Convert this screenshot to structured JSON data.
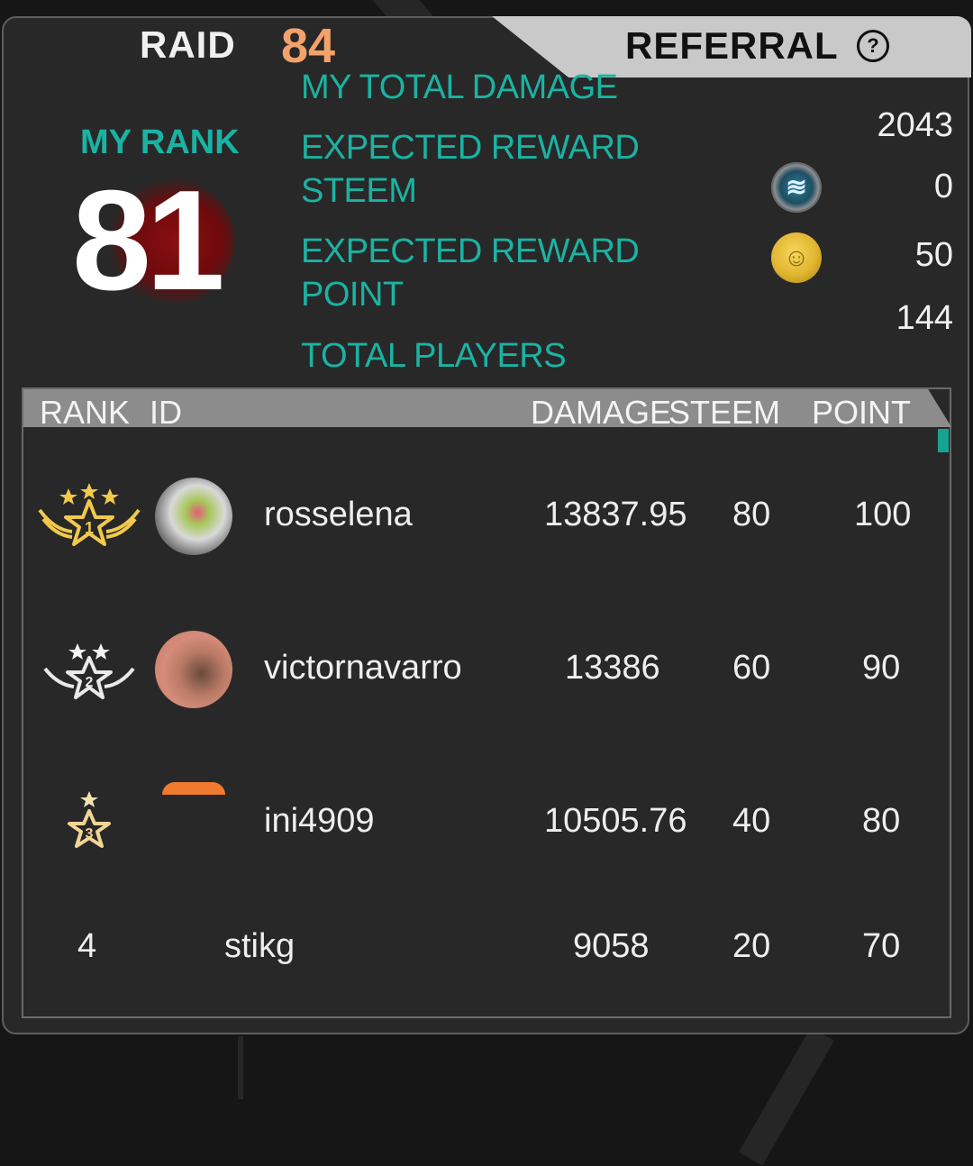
{
  "tabs": {
    "raid_label": "RAID",
    "raid_number": "84",
    "referral_label": "REFERRAL",
    "help_glyph": "?"
  },
  "summary": {
    "my_rank_label": "MY RANK",
    "my_rank_value": "81",
    "total_damage_label": "MY TOTAL DAMAGE",
    "total_damage_value": "2043",
    "reward_steem_label_1": "EXPECTED REWARD",
    "reward_steem_label_2": "STEEM",
    "reward_steem_value": "0",
    "reward_point_label_1": "EXPECTED REWARD",
    "reward_point_label_2": "POINT",
    "reward_point_value": "50",
    "total_players_label": "TOTAL PLAYERS",
    "total_players_value": "144",
    "steem_icon": "steem-coin-icon",
    "point_icon": "gold-point-coin-icon"
  },
  "table": {
    "headers": {
      "rank": "RANK",
      "id": "ID",
      "damage": "DAMAGE",
      "steem": "STEEM",
      "point": "POINT"
    },
    "rows": [
      {
        "rank": "1",
        "id": "rosselena",
        "damage": "13837.95",
        "steem": "80",
        "point": "100"
      },
      {
        "rank": "2",
        "id": "victornavarro",
        "damage": "13386",
        "steem": "60",
        "point": "90"
      },
      {
        "rank": "3",
        "id": "ini4909",
        "damage": "10505.76",
        "steem": "40",
        "point": "80"
      },
      {
        "rank": "4",
        "id": "stikg",
        "damage": "9058",
        "steem": "20",
        "point": "70"
      }
    ]
  },
  "colors": {
    "accent_teal": "#1ab3a3",
    "raid_number_orange": "#f4a26b",
    "gold": "#f2c94c"
  }
}
